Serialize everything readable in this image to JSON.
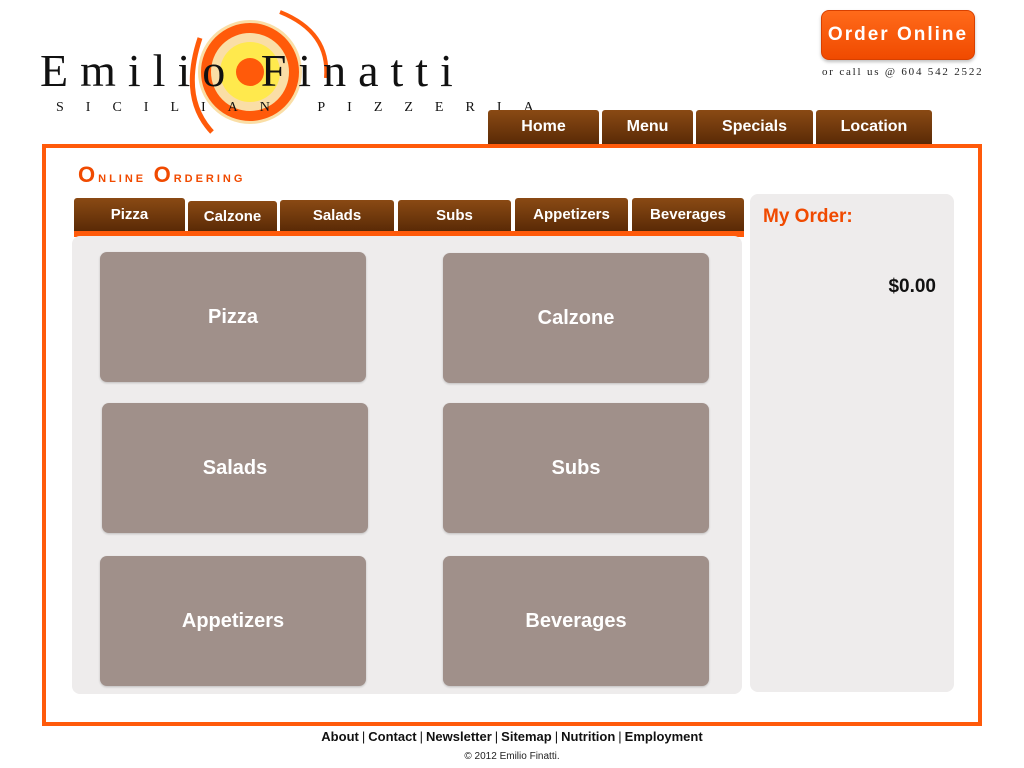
{
  "brand": {
    "name": "Emilio Finatti",
    "tagline": "Sicilian Pizzeria",
    "colors": {
      "accent": "#ff5a0a",
      "nav": "#6b3508",
      "tile": "#a0908a",
      "panel": "#eeecec"
    }
  },
  "header": {
    "order_online_label": "Order Online",
    "call_text": "or call us @ 604 542 2522"
  },
  "nav": {
    "items": [
      {
        "label": "Home"
      },
      {
        "label": "Menu"
      },
      {
        "label": "Specials"
      },
      {
        "label": "Location"
      }
    ]
  },
  "ordering": {
    "title_first_cap": "O",
    "title_first_rest": "nline",
    "title_second_cap": "O",
    "title_second_rest": "rdering",
    "tabs": [
      {
        "label": "Pizza"
      },
      {
        "label": "Calzone"
      },
      {
        "label": "Salads"
      },
      {
        "label": "Subs"
      },
      {
        "label": "Appetizers"
      },
      {
        "label": "Beverages"
      }
    ],
    "tiles": [
      {
        "label": "Pizza"
      },
      {
        "label": "Calzone"
      },
      {
        "label": "Salads"
      },
      {
        "label": "Subs"
      },
      {
        "label": "Appetizers"
      },
      {
        "label": "Beverages"
      }
    ]
  },
  "my_order": {
    "title": "My Order:",
    "total": "$0.00"
  },
  "footer": {
    "links": [
      {
        "label": "About"
      },
      {
        "label": "Contact"
      },
      {
        "label": "Newsletter"
      },
      {
        "label": "Sitemap"
      },
      {
        "label": "Nutrition"
      },
      {
        "label": "Employment"
      }
    ],
    "separator": "|",
    "copyright": "© 2012 Emilio Finatti."
  }
}
